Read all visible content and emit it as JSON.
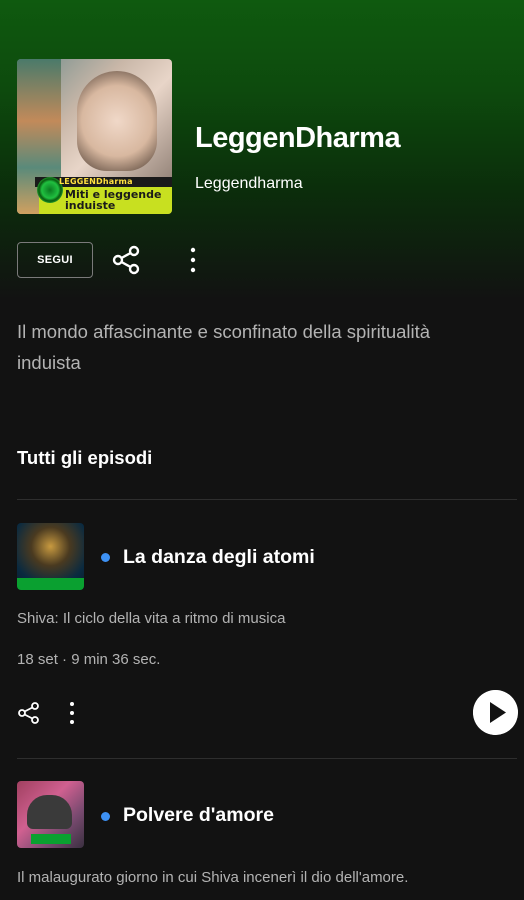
{
  "podcast": {
    "title": "LeggenDharma",
    "author": "Leggendharma",
    "cover_label_top": "LEGGENDharma",
    "cover_label_main": "Miti e leggende induiste",
    "follow_label": "SEGUI",
    "description": "Il mondo affascinante e sconfinato della spiritualità induista"
  },
  "episodes_section": {
    "title": "Tutti gli episodi"
  },
  "episodes": [
    {
      "title": "La danza degli atomi",
      "description": "Shiva: Il ciclo della vita a ritmo di musica",
      "meta": "18 set · 9 min 36 sec."
    },
    {
      "title": "Polvere d'amore",
      "description": "Il malaugurato giorno in cui Shiva incenerì il dio dell'amore."
    }
  ],
  "icons": {
    "share": "share-icon",
    "more": "more-vertical-icon",
    "play": "play-icon",
    "new_dot": "new-episode-dot"
  },
  "colors": {
    "accent_green": "#0f5a0f",
    "background": "#121212",
    "new_dot": "#3d91f4"
  }
}
